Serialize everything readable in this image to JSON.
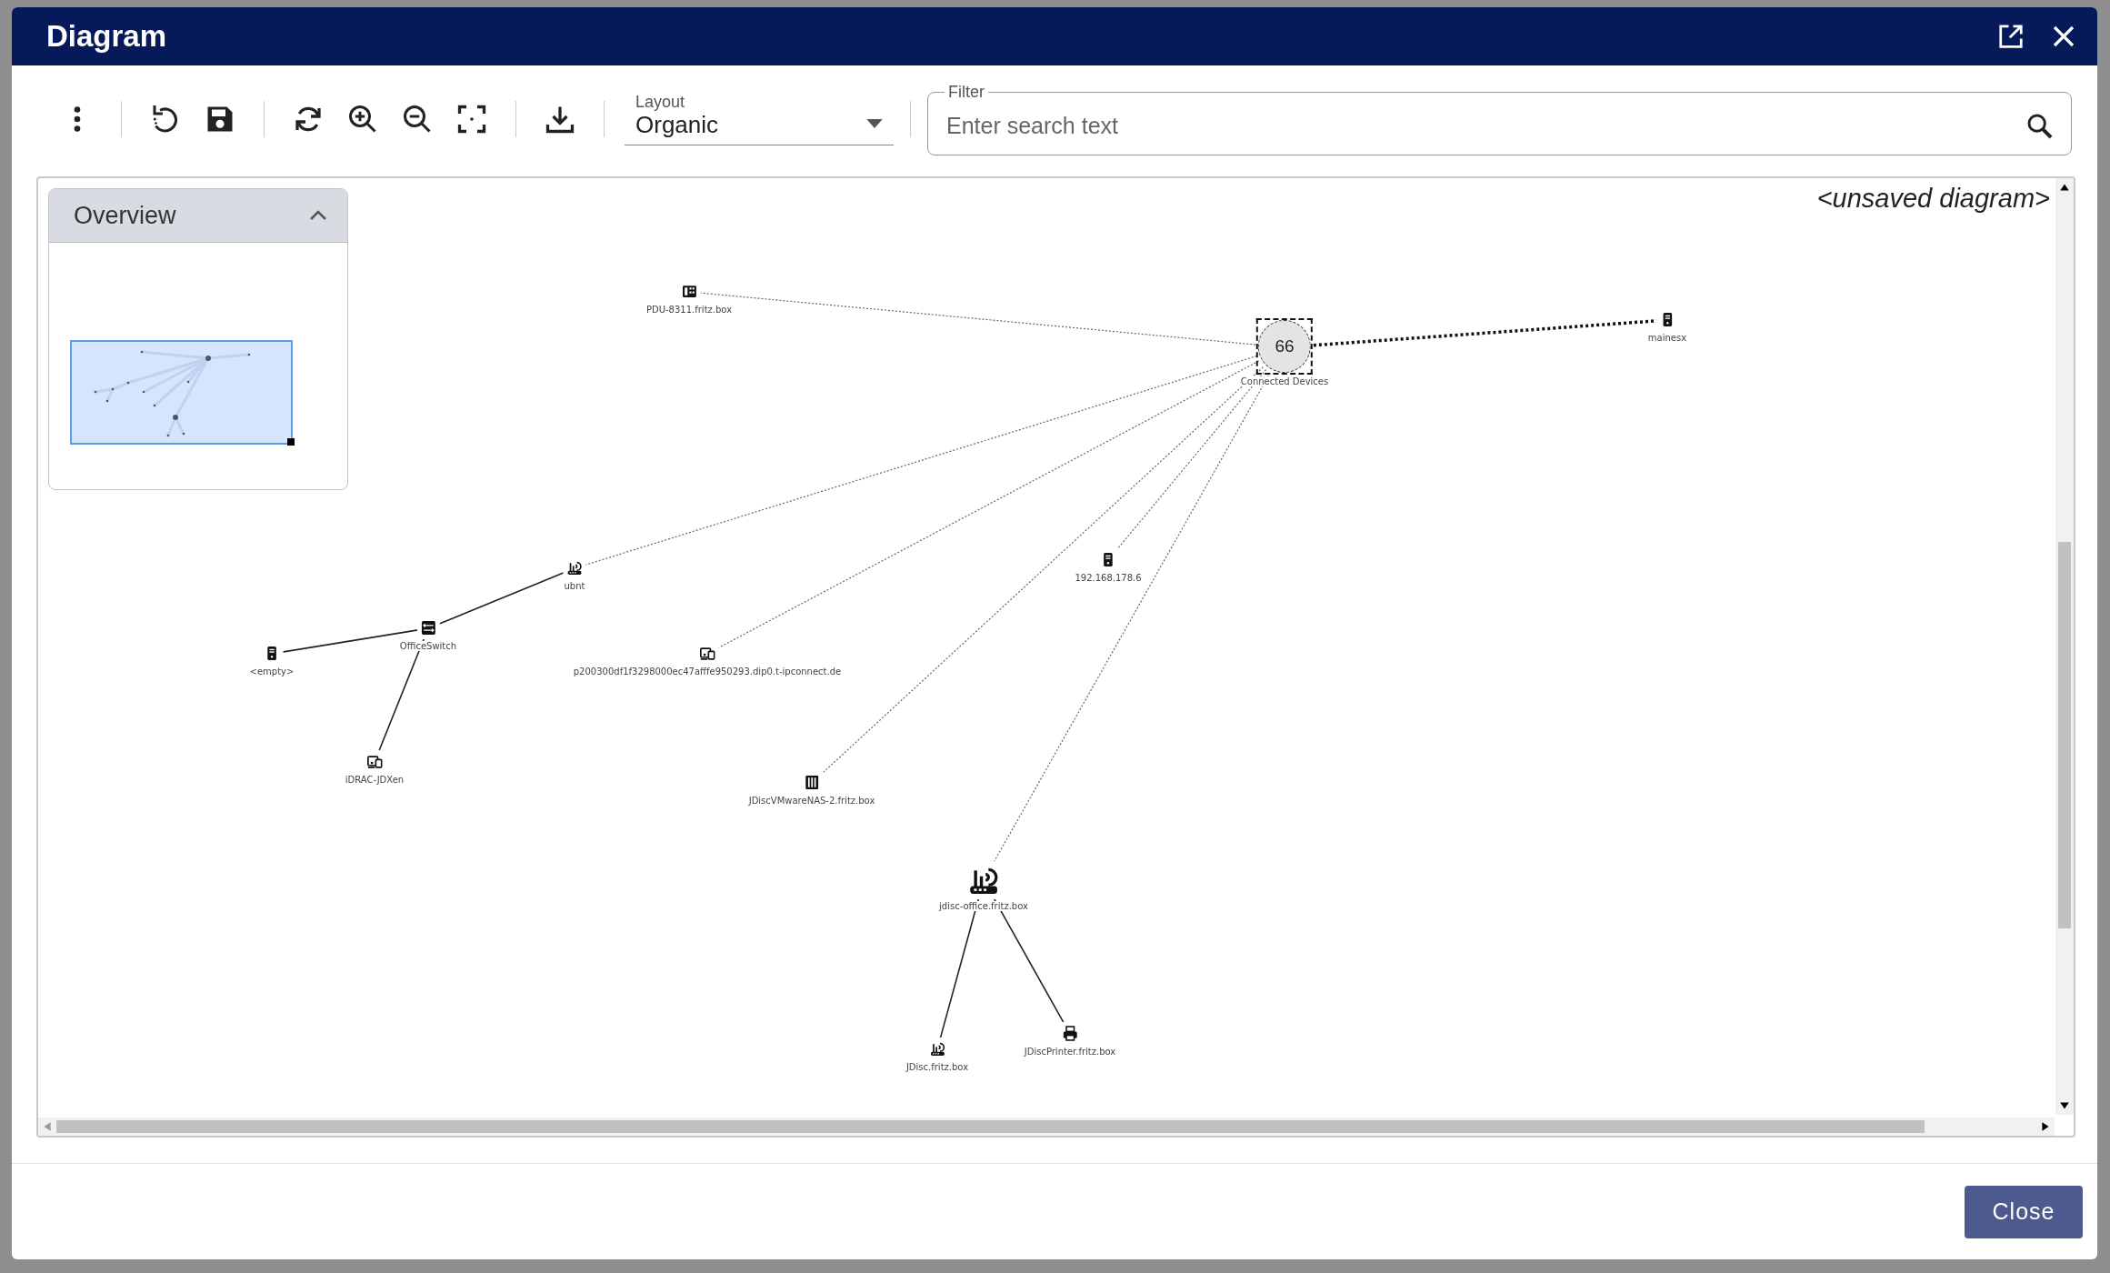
{
  "window": {
    "title": "Diagram"
  },
  "toolbar": {
    "buttons": [
      {
        "kind": "more"
      },
      {
        "kind": "separator"
      },
      {
        "kind": "reset"
      },
      {
        "kind": "save"
      },
      {
        "kind": "separator"
      },
      {
        "kind": "refresh"
      },
      {
        "kind": "zoom-in"
      },
      {
        "kind": "zoom-out"
      },
      {
        "kind": "fit"
      },
      {
        "kind": "separator"
      },
      {
        "kind": "download"
      },
      {
        "kind": "separator"
      }
    ]
  },
  "layout_select": {
    "label": "Layout",
    "value": "Organic"
  },
  "filter": {
    "label": "Filter",
    "placeholder": "Enter search text"
  },
  "diagram": {
    "caption": "<unsaved diagram>",
    "overview": {
      "title": "Overview",
      "expanded": true
    },
    "root": {
      "label": "Connected Devices",
      "count": "66",
      "kind": "hub",
      "selected": true,
      "children": [
        {
          "label": "PDU-8311.fritz.box",
          "kind": "pdu",
          "link": {
            "kind": "dotted"
          },
          "selected": false
        },
        {
          "label": "mainesx",
          "kind": "server",
          "link": {
            "kind": "bold-dotted"
          },
          "selected": false
        },
        {
          "label": "ubnt",
          "kind": "router",
          "link": {
            "kind": "dotted"
          },
          "selected": false,
          "children": [
            {
              "label": "OfficeSwitch",
              "kind": "switch",
              "link": {
                "kind": "solid"
              },
              "selected": false,
              "children": [
                {
                  "label": "<empty>",
                  "kind": "server",
                  "link": {
                    "kind": "solid"
                  },
                  "selected": false
                },
                {
                  "label": "iDRAC-JDXen",
                  "kind": "device",
                  "link": {
                    "kind": "solid"
                  },
                  "selected": false
                }
              ]
            }
          ]
        },
        {
          "label": "p200300df1f3298000ec47afffe950293.dip0.t-ipconnect.de",
          "kind": "device",
          "link": {
            "kind": "dotted"
          },
          "selected": false
        },
        {
          "label": "192.168.178.6",
          "kind": "server",
          "link": {
            "kind": "dotted"
          },
          "selected": false
        },
        {
          "label": "JDiscVMwareNAS-2.fritz.box",
          "kind": "nas",
          "link": {
            "kind": "dotted"
          },
          "selected": false
        },
        {
          "label": "jdisc-office.fritz.box",
          "kind": "router-large",
          "link": {
            "kind": "dotted"
          },
          "selected": false,
          "children": [
            {
              "label": "JDisc.fritz.box",
              "kind": "router",
              "link": {
                "kind": "solid"
              },
              "selected": false
            },
            {
              "label": "JDiscPrinter.fritz.box",
              "kind": "printer",
              "link": {
                "kind": "solid"
              },
              "selected": false
            }
          ]
        }
      ]
    }
  },
  "footer": {
    "buttons": [
      "Close"
    ]
  }
}
